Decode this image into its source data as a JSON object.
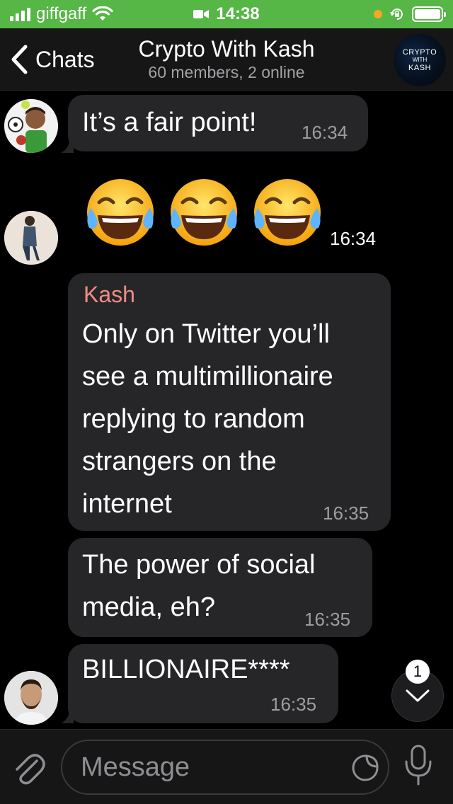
{
  "status_bar": {
    "carrier": "giffgaff",
    "time": "14:38"
  },
  "nav": {
    "back_label": "Chats",
    "title": "Crypto With Kash",
    "subtitle": "60 members, 2 online",
    "avatar_text": [
      "CRYPTO",
      "WITH",
      "KASH"
    ]
  },
  "messages": [
    {
      "text": "It’s a fair point!",
      "time": "16:34"
    },
    {
      "emoji": "😂😂😂",
      "time": "16:34"
    },
    {
      "sender": "Kash",
      "lines": [
        "Only on Twitter you’ll",
        "see a multimillionaire",
        "replying to random",
        "strangers on the",
        "internet"
      ],
      "time": "16:35"
    },
    {
      "lines": [
        "The power of social",
        "media, eh?"
      ],
      "time": "16:35"
    },
    {
      "text": "BILLIONAIRE****",
      "time": "16:35"
    }
  ],
  "scroll_badge": "1",
  "input": {
    "placeholder": "Message"
  },
  "colors": {
    "status_bar": "#56b646",
    "bubble": "#262628",
    "sender_name": "#f08c86",
    "time": "#9d9da1"
  }
}
